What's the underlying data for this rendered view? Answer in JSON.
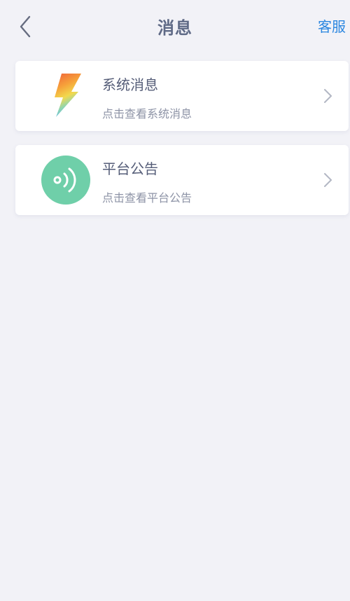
{
  "nav": {
    "title": "消息",
    "service_label": "客服",
    "back_icon": "chevron-left-icon"
  },
  "messages": [
    {
      "title": "系统消息",
      "subtitle": "点击查看系统消息",
      "icon": "lightning-icon"
    },
    {
      "title": "平台公告",
      "subtitle": "点击查看平台公告",
      "icon": "broadcast-icon"
    }
  ],
  "colors": {
    "background": "#f2f2f7",
    "title": "#5f6a86",
    "accent_link": "#2a86e0",
    "announcement_icon_bg": "#6fcfa9",
    "card_bg": "#ffffff"
  }
}
